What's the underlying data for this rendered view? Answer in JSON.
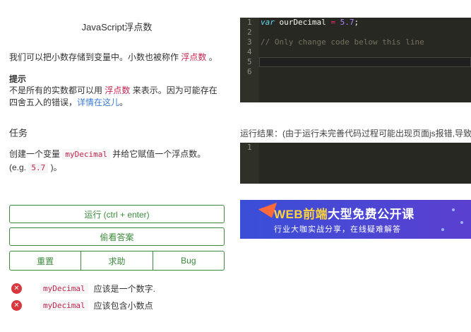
{
  "lesson": {
    "title": "JavaScript浮点数",
    "intro_pre": "我们可以把小数存储到变量中。小数也被称作 ",
    "intro_term": "浮点数",
    "intro_post": " 。",
    "tip_heading": "提示",
    "tip_pre": "不是所有的实数都可以用 ",
    "tip_term": "浮点数",
    "tip_mid": " 来表示。因为可能存在四舍五入的错误，",
    "tip_link": "详情在这儿",
    "tip_post": "。",
    "task_heading": "任务",
    "task_line1_pre": "创建一个变量 ",
    "task_var": "myDecimal",
    "task_line1_post": " 并给它赋值一个浮点数。",
    "task_line2_pre": "(e.g. ",
    "task_example": "5.7",
    "task_line2_post": " )。"
  },
  "buttons": {
    "run": "运行 (ctrl + enter)",
    "answer": "偷看答案",
    "reset": "重置",
    "help": "求助",
    "bug": "Bug"
  },
  "tests": [
    {
      "code": "myDecimal",
      "text": "应该是一个数字."
    },
    {
      "code": "myDecimal",
      "text": "应该包含小数点"
    }
  ],
  "editor": {
    "line_numbers": [
      "1",
      "2",
      "3",
      "4",
      "5",
      "6"
    ],
    "line1_kw": "var",
    "line1_name": " ourDecimal ",
    "line1_op": "=",
    "line1_num": " 5.7",
    "line1_end": ";",
    "line3_comment": "// Only change code below this line"
  },
  "result": {
    "label": "运行结果：(由于运行未完善代码过程可能出现页面js报错,导致",
    "line_numbers": [
      "1"
    ]
  },
  "banner": {
    "title_yellow": "WEB前端",
    "title_white": "大型免费公开课",
    "subtitle": "行业大咖实战分享，在线疑难解答"
  },
  "colors": {
    "accent_green": "#3c8a3c",
    "error_red": "#d9363e",
    "code_highlight": "#c7254e",
    "editor_bg": "#272822"
  }
}
